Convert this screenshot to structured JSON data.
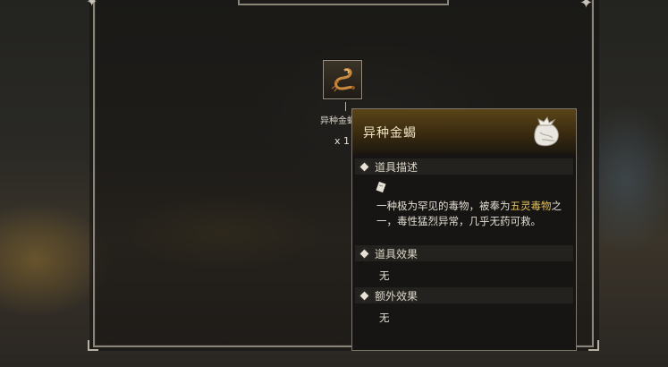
{
  "item": {
    "name_small": "异种金蝎",
    "count": "x 1",
    "icon": "golden-scorpion-icon"
  },
  "tooltip": {
    "title": "异种金蝎",
    "header_icon": "item-pouch-icon",
    "sections": {
      "description": {
        "label": "道具描述",
        "text_before": "一种极为罕见的毒物，被奉为",
        "highlight": "五灵毒物",
        "text_after": "之一，毒性猛烈异常，几乎无药可救。"
      },
      "effect": {
        "label": "道具效果",
        "value": "无"
      },
      "extra_effect": {
        "label": "额外效果",
        "value": "无"
      }
    }
  },
  "colors": {
    "highlight": "#e8c25b",
    "header_gold": "#5a4418",
    "frame": "#8a8479"
  }
}
